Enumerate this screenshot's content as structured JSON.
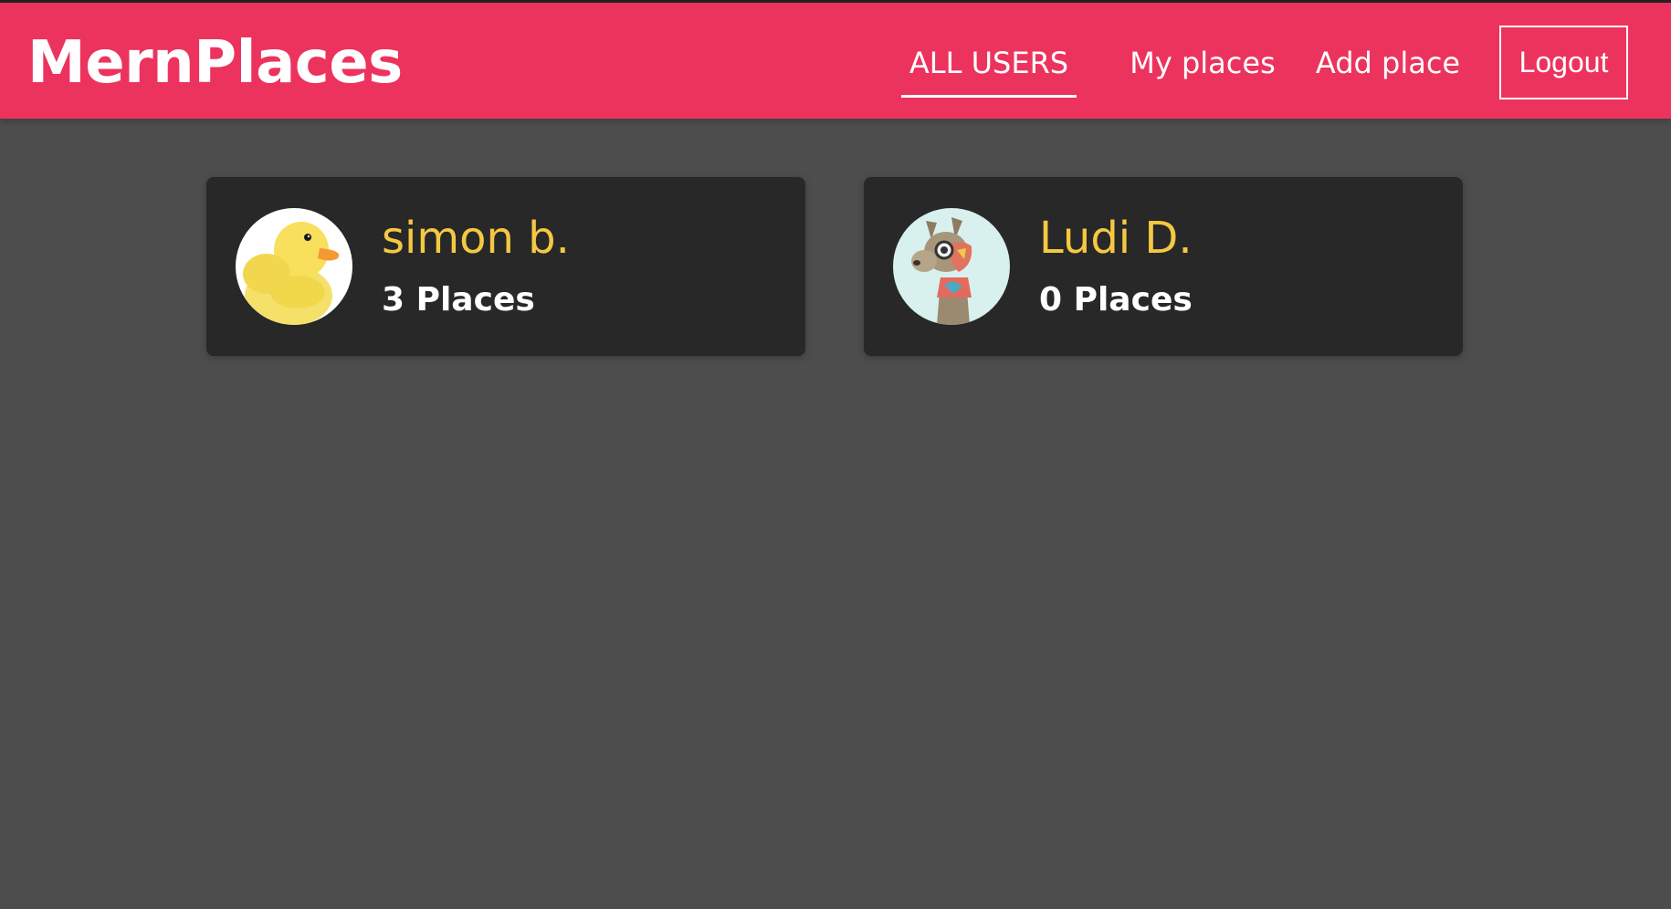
{
  "app": {
    "title": "MernPlaces",
    "colors": {
      "header": "#ec335e",
      "background": "#4d4d4d",
      "card": "#282828",
      "user_name": "#f5c842",
      "text": "#ffffff"
    }
  },
  "nav": {
    "links": [
      {
        "label": "ALL USERS",
        "active": true
      },
      {
        "label": "My places",
        "active": false
      },
      {
        "label": "Add place",
        "active": false
      }
    ],
    "logout_label": "Logout"
  },
  "users": [
    {
      "name": "simon b.",
      "places": "3 Places",
      "avatar_icon": "rubber-duck-icon"
    },
    {
      "name": "Ludi D.",
      "places": "0 Places",
      "avatar_icon": "llama-icon"
    }
  ]
}
